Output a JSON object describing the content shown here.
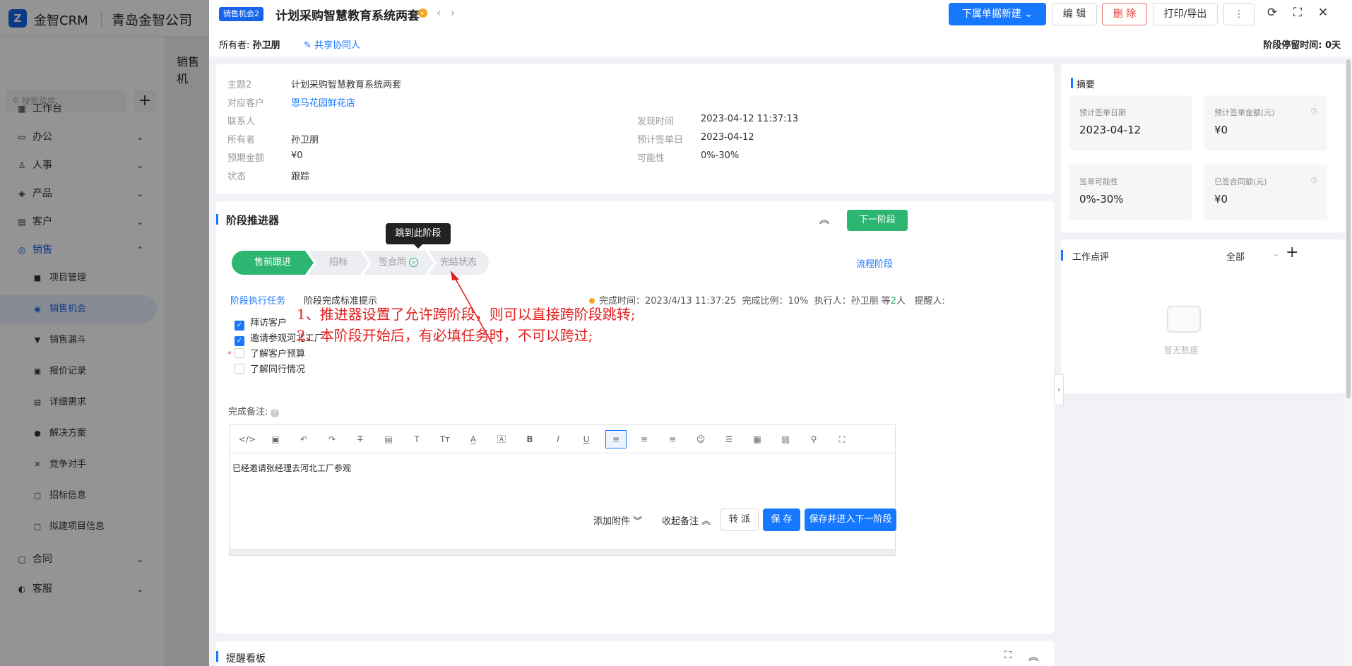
{
  "background": {
    "brand": "金智CRM",
    "company": "青岛金智公司",
    "search_placeholder": "搜索菜单",
    "page_tab": "销售机",
    "sidebar": [
      {
        "label": "工作台",
        "icon": "dashboard-icon"
      },
      {
        "label": "办公",
        "icon": "office-icon"
      },
      {
        "label": "人事",
        "icon": "people-icon"
      },
      {
        "label": "产品",
        "icon": "product-icon"
      },
      {
        "label": "客户",
        "icon": "customer-icon"
      },
      {
        "label": "销售",
        "icon": "sales-icon"
      }
    ],
    "sales_sub": [
      {
        "label": "项目管理",
        "icon": "folder-icon"
      },
      {
        "label": "销售机会",
        "icon": "opportunity-icon"
      },
      {
        "label": "销售漏斗",
        "icon": "funnel-icon"
      },
      {
        "label": "报价记录",
        "icon": "quote-icon"
      },
      {
        "label": "详细需求",
        "icon": "doc-icon"
      },
      {
        "label": "解决方案",
        "icon": "bulb-icon"
      },
      {
        "label": "竞争对手",
        "icon": "competitor-icon"
      },
      {
        "label": "招标信息",
        "icon": "bid-icon"
      },
      {
        "label": "拟建项目信息",
        "icon": "plan-icon"
      }
    ],
    "sidebar_bottom": [
      {
        "label": "合同",
        "icon": "contract-icon"
      },
      {
        "label": "客服",
        "icon": "service-icon"
      }
    ]
  },
  "header": {
    "badge": "销售机会2",
    "title": "计划采购智慧教育系统两套",
    "buttons": {
      "sub_new": "下属单据新建",
      "edit": "编 辑",
      "delete": "删 除",
      "print": "打印/导出",
      "more": "⋮"
    },
    "owner_label": "所有者:",
    "owner_name": "孙卫朋",
    "share": "共享协同人",
    "stay_time": "阶段停留时间: 0天"
  },
  "info": {
    "left": [
      {
        "k": "主题2",
        "v": "计划采购智慧教育系统两套"
      },
      {
        "k": "对应客户",
        "v": "恩马花园鲜花店"
      },
      {
        "k": "联系人",
        "v": ""
      },
      {
        "k": "所有者",
        "v": "孙卫朋"
      },
      {
        "k": "预期金额",
        "v": "¥0"
      },
      {
        "k": "状态",
        "v": "跟踪"
      }
    ],
    "right": [
      {
        "k": "发现时间",
        "v": "2023-04-12 11:37:13"
      },
      {
        "k": "预计签单日",
        "v": "2023-04-12"
      },
      {
        "k": "可能性",
        "v": "0%-30%"
      }
    ]
  },
  "stage": {
    "title": "阶段推进器",
    "next_button": "下一阶段",
    "flow_link": "流程阶段",
    "steps": [
      "售前跟进",
      "招标",
      "签合同",
      "完结状态"
    ],
    "tooltip": "跳到此阶段",
    "tabs": {
      "tasks": "阶段执行任务",
      "standard": "阶段完成标准提示"
    },
    "status": {
      "done_time": "完成时间：2023/4/13 11:37:25",
      "ratio": "完成比例：10%",
      "executor": "执行人：孙卫朋 等",
      "executor_count": "2",
      "executor_suffix": "人",
      "reminder": "提醒人:"
    },
    "tasks": [
      {
        "label": "拜访客户",
        "checked": true,
        "required": false
      },
      {
        "label": "邀请参观河北工厂",
        "checked": true,
        "required": false
      },
      {
        "label": "了解客户预算",
        "checked": false,
        "required": true
      },
      {
        "label": "了解同行情况",
        "checked": false,
        "required": false
      }
    ],
    "note_label": "完成备注:",
    "note_text": "已经邀请张经理去河北工厂参观",
    "footer": {
      "attach": "添加附件",
      "collapse": "收起备注",
      "transfer": "转 派",
      "save": "保 存",
      "save_next": "保存并进入下一阶段"
    }
  },
  "remind": {
    "title": "提醒看板"
  },
  "summary": {
    "title": "摘要",
    "metrics": [
      {
        "label": "预计签单日期",
        "value": "2023-04-12"
      },
      {
        "label": "预计签单金额(元)",
        "value": "¥0"
      },
      {
        "label": "签单可能性",
        "value": "0%-30%"
      },
      {
        "label": "已签合同额(元)",
        "value": "¥0"
      }
    ]
  },
  "review": {
    "title": "工作点评",
    "filter": "全部",
    "empty": "暂无数据"
  },
  "annotation": {
    "line1": "1、推进器设置了允许跨阶段，则可以直接跨阶段跳转;",
    "line2": "2、本阶段开始后，有必填任务时，不可以跨过;"
  },
  "colors": {
    "primary": "#1677ff",
    "success": "#2db672",
    "danger": "#e53935",
    "annotation": "#e32020"
  }
}
